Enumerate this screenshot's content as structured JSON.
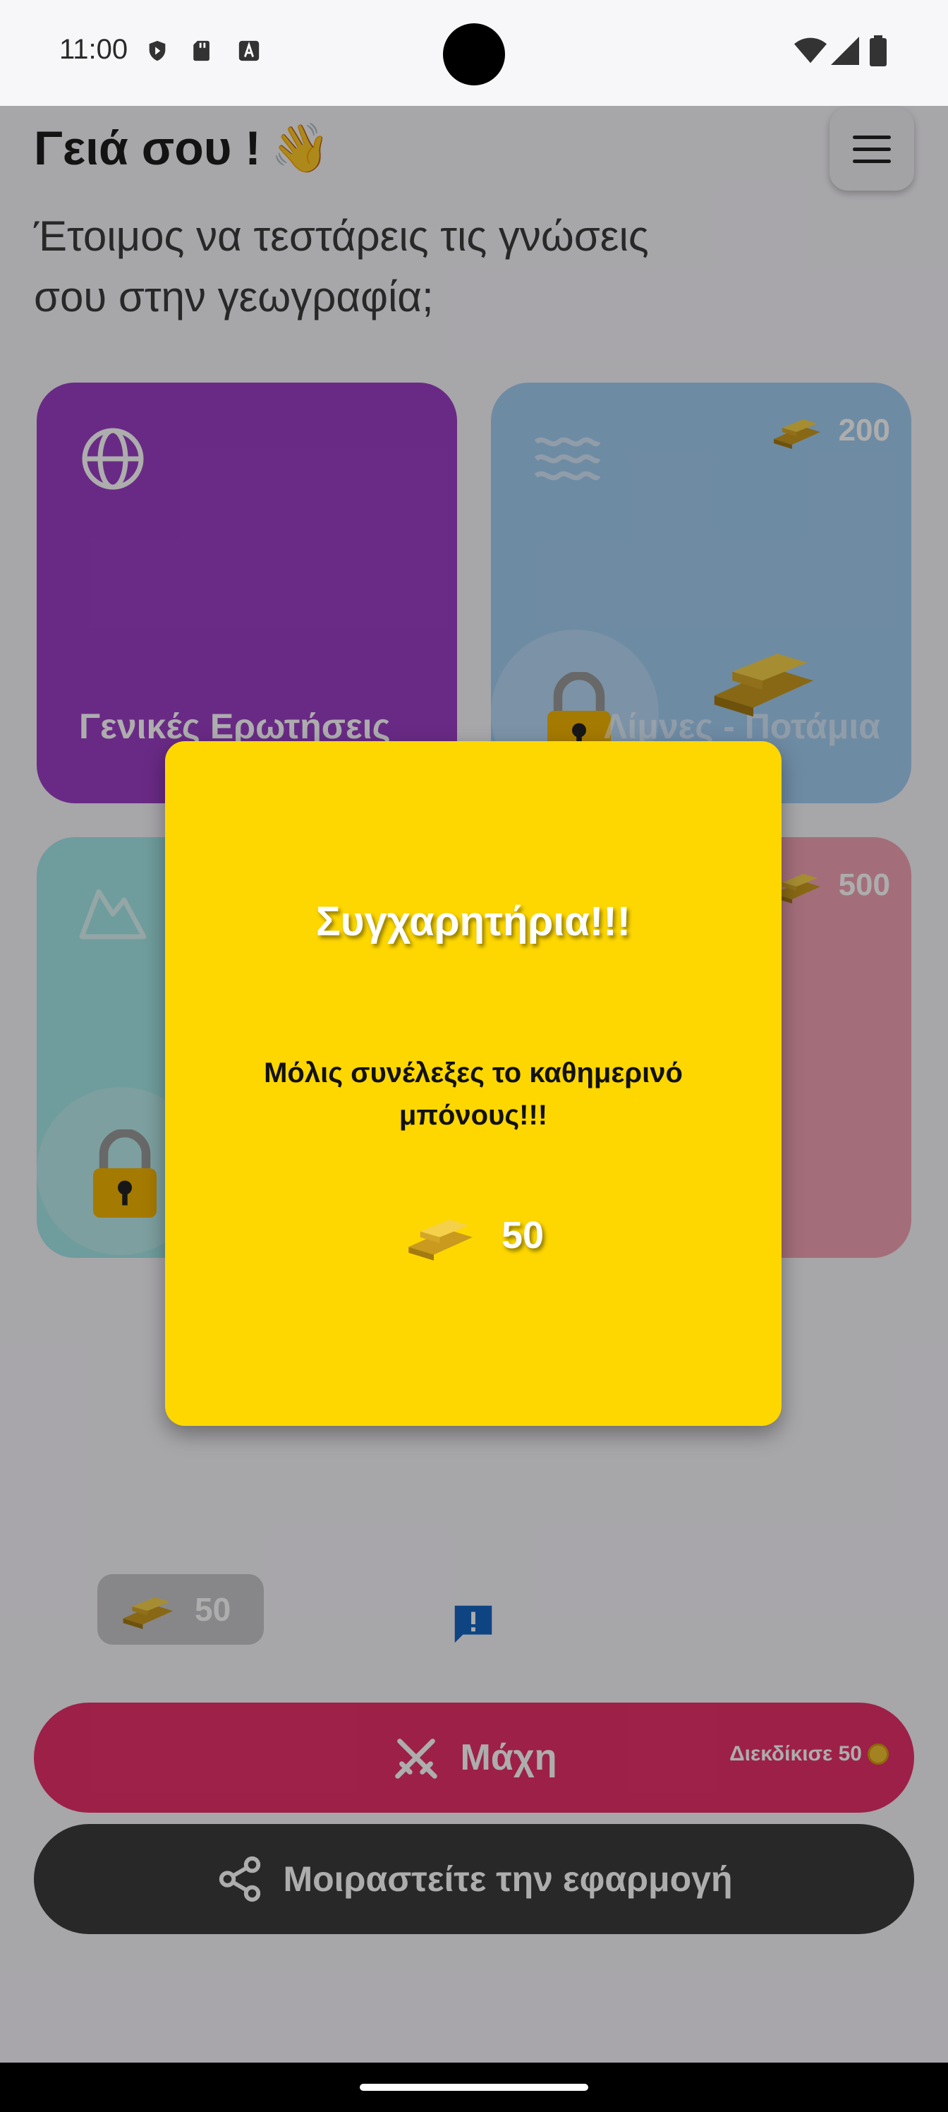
{
  "status_bar": {
    "time": "11:00"
  },
  "header": {
    "greeting": "Γειά σου !",
    "wave_emoji": "👋",
    "subtitle": "Έτοιμος να τεστάρεις τις γνώσεις σου στην γεωγραφία;"
  },
  "categories": [
    {
      "label": "Γενικές Ερωτήσεις",
      "icon": "globe-icon",
      "color": "#9b3fc4",
      "locked": false
    },
    {
      "label": "Λίμνες - Ποτάμια",
      "icon": "waves-icon",
      "color": "#a3cdf2",
      "locked": true,
      "price": "200"
    },
    {
      "label": "",
      "icon": "mountain-icon",
      "color": "#a4e6e6",
      "locked": true
    },
    {
      "label": "",
      "icon": "",
      "color": "#f0a2b4",
      "locked": true,
      "price": "500"
    }
  ],
  "coins_balance": "50",
  "buttons": {
    "battle_label": "Μάχη",
    "claim_label": "Διεκδίκισε 50",
    "share_label": "Μοιραστείτε την εφαρμογή"
  },
  "dialog": {
    "title": "Συγχαρητήρια!!!",
    "message": "Μόλις συνέλεξες το καθημερινό μπόνους!!!",
    "reward_amount": "50",
    "background": "#fed700"
  },
  "colors": {
    "battle": "#e8306a",
    "share": "#3c3c3c",
    "gold": "#f1c232"
  }
}
